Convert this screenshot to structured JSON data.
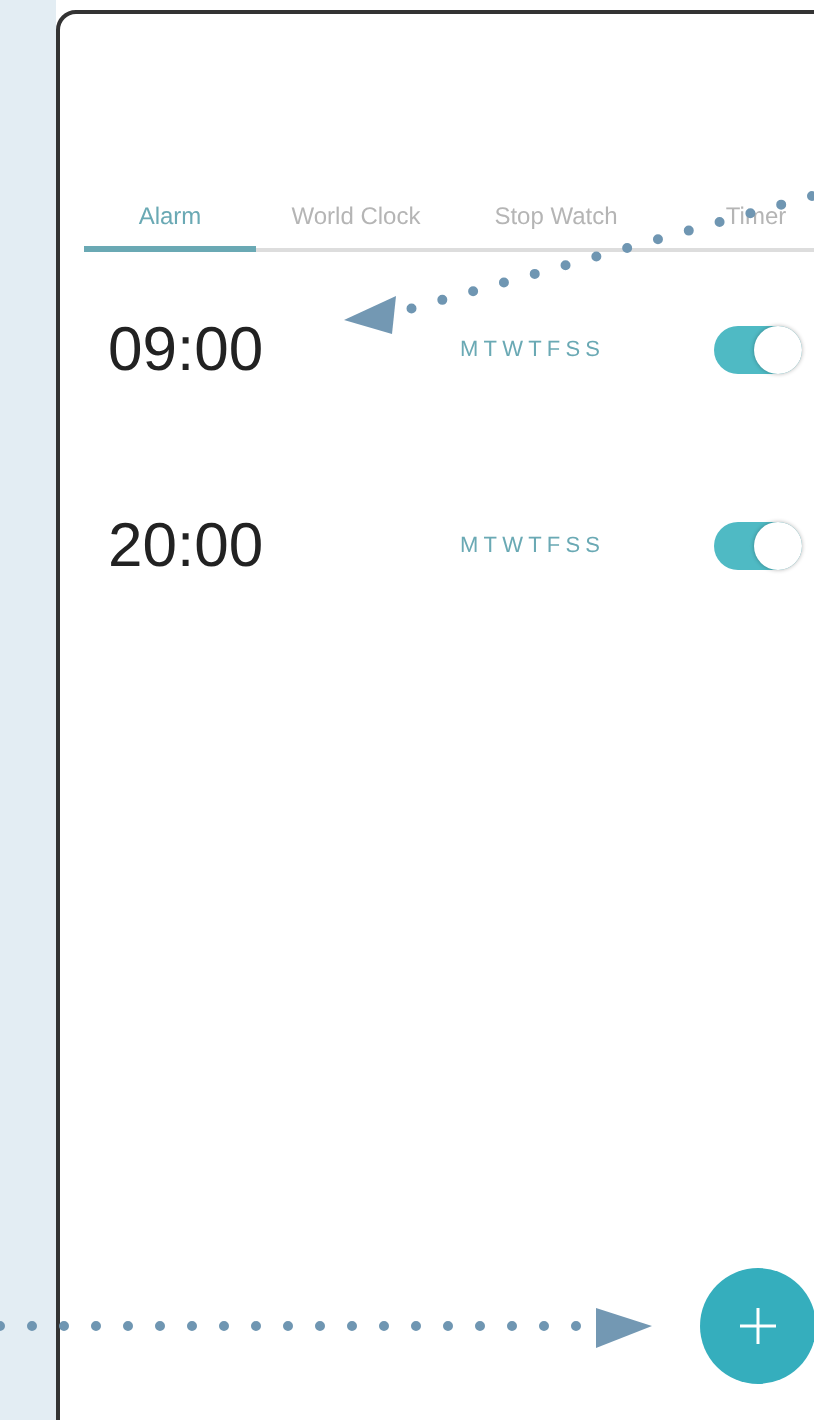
{
  "tabs": [
    {
      "label": "Alarm",
      "selected": true
    },
    {
      "label": "World Clock",
      "selected": false
    },
    {
      "label": "Stop Watch",
      "selected": false
    },
    {
      "label": "Timer",
      "selected": false
    }
  ],
  "alarms": [
    {
      "time": "09:00",
      "days": "MTWTFSS",
      "on": true
    },
    {
      "time": "20:00",
      "days": "MTWTFSS",
      "on": true
    }
  ]
}
